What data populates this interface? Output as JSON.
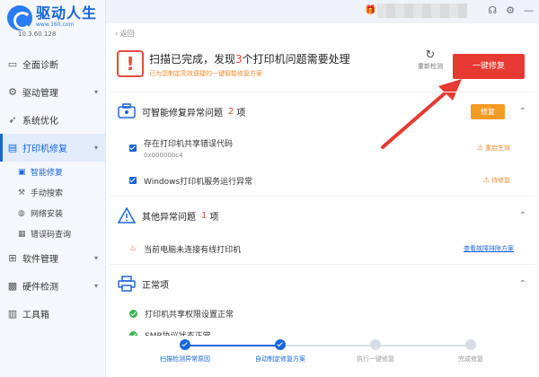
{
  "app": {
    "name": "驱动人生",
    "url": "www.160.com",
    "version": "10.3.60.128"
  },
  "sidebar": {
    "items": [
      {
        "label": "全面诊断",
        "icon": "monitor-icon"
      },
      {
        "label": "驱动管理",
        "icon": "gear-icon"
      },
      {
        "label": "系统优化",
        "icon": "rocket-icon"
      },
      {
        "label": "打印机修复",
        "icon": "printer-icon"
      },
      {
        "label": "软件管理",
        "icon": "grid-icon"
      },
      {
        "label": "硬件检测",
        "icon": "chip-icon"
      },
      {
        "label": "工具箱",
        "icon": "toolbox-icon"
      }
    ],
    "subitems": [
      {
        "label": "智能修复",
        "icon": "document-icon"
      },
      {
        "label": "手动搜索",
        "icon": "wrench-icon"
      },
      {
        "label": "网络安装",
        "icon": "globe-icon"
      },
      {
        "label": "错误码查询",
        "icon": "code-icon"
      }
    ]
  },
  "header": {
    "back_label": "返回",
    "summary_prefix": "扫描已完成，发现",
    "issue_count": "3",
    "summary_suffix": "个打印机问题需要处理",
    "summary_sub": "已为您制定高效便捷的一键智能修复方案",
    "rescan_label": "重新检测",
    "fix_all_label": "一键修复"
  },
  "sections": {
    "smart": {
      "title": "可智能修复异常问题",
      "count": "2",
      "unit": "项",
      "fix_label": "修复",
      "rows": [
        {
          "text": "存在打印机共享错误代码",
          "code": "0x00000bc4",
          "action": "重启生效"
        },
        {
          "text": "Windows打印机服务运行异常",
          "action": "待修复"
        }
      ]
    },
    "other": {
      "title": "其他异常问题",
      "count": "1",
      "unit": "项",
      "rows": [
        {
          "text": "当前电脑未连接有线打印机",
          "link": "查看故障排除方案"
        }
      ]
    },
    "normal": {
      "title": "正常项",
      "rows": [
        {
          "text": "打印机共享权限设置正常"
        },
        {
          "text": "SMB协议状态正常"
        }
      ]
    }
  },
  "progress": {
    "steps": [
      {
        "label": "扫描检测异常原因",
        "done": true
      },
      {
        "label": "自动制定修复方案",
        "done": true
      },
      {
        "label": "执行一键修复",
        "done": false
      },
      {
        "label": "完成修复",
        "done": false
      }
    ],
    "completed_fraction": 0.333
  },
  "colors": {
    "accent": "#1a66d9",
    "danger": "#e63a32",
    "warning": "#f39c25",
    "success": "#3cb451"
  }
}
